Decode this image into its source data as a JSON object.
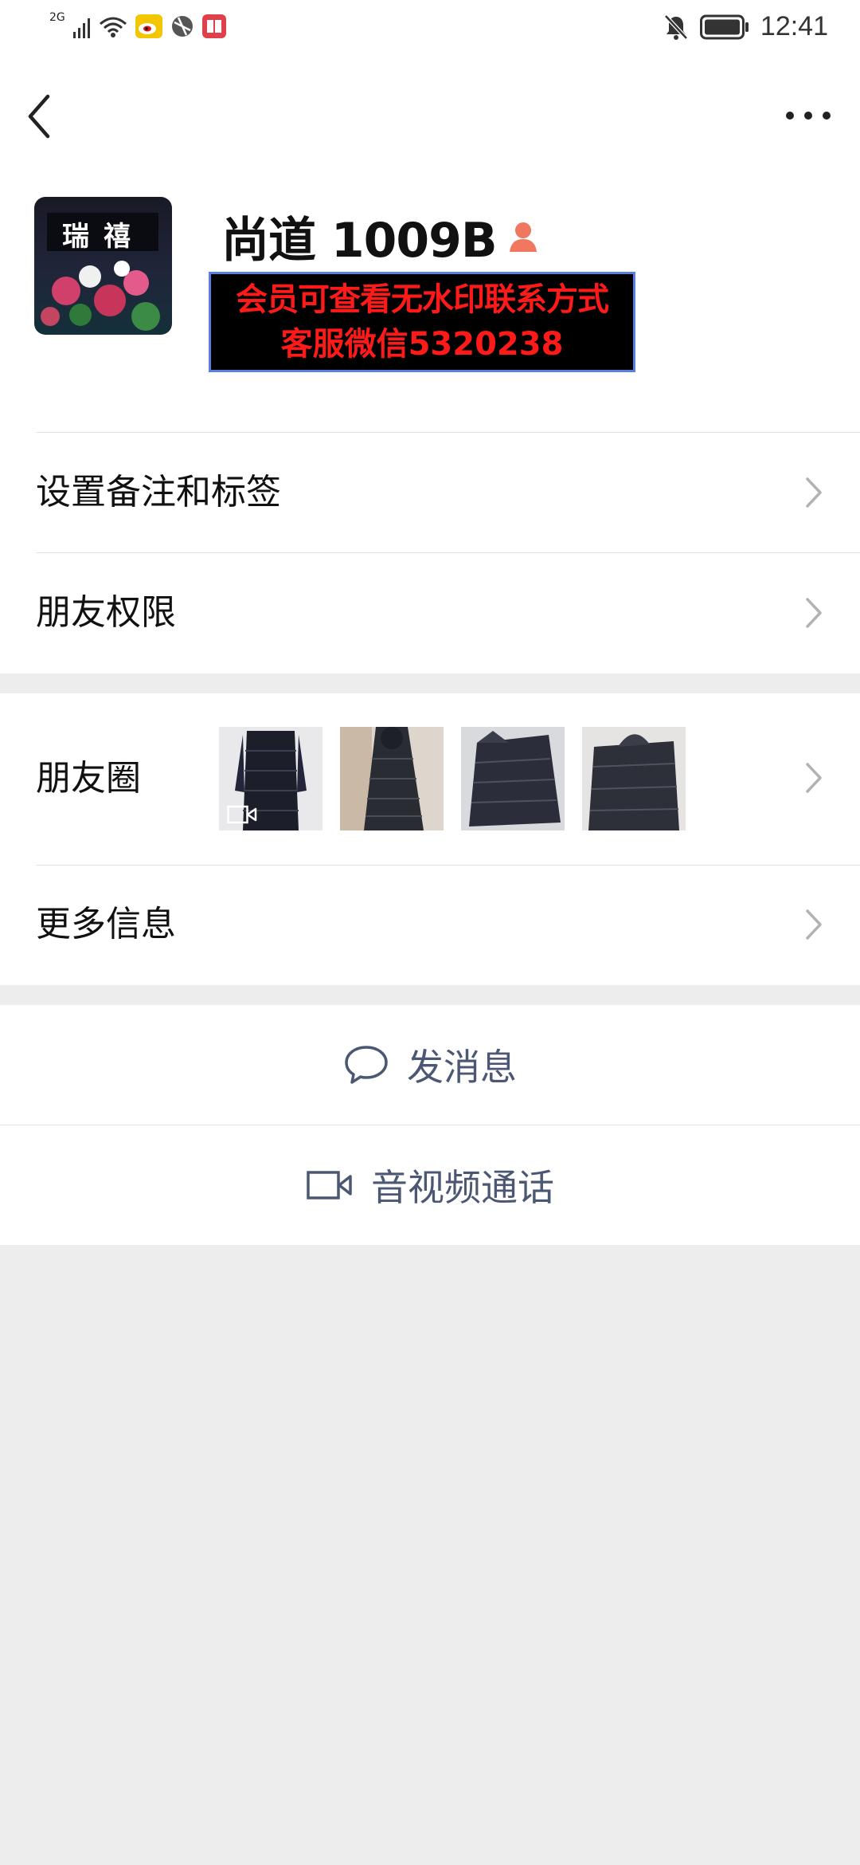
{
  "status_bar": {
    "network_type": "2G",
    "time": "12:41",
    "icons": [
      "signal-icon",
      "wifi-icon",
      "weibo-icon",
      "browser-icon",
      "reader-app-icon",
      "mute-bell-icon",
      "battery-icon"
    ]
  },
  "nav": {
    "back_icon": "chevron-left-icon",
    "more_icon": "more-dots-icon"
  },
  "profile": {
    "avatar_text": "瑞禧",
    "name": "尚道 1009B",
    "gender_icon": "female-icon",
    "notice_line1": "会员可查看无水印联系方式",
    "notice_line2": "客服微信5320238"
  },
  "menu": {
    "remark_tags": "设置备注和标签",
    "friend_permissions": "朋友权限",
    "moments": "朋友圈",
    "more_info": "更多信息"
  },
  "actions": {
    "send_message": "发消息",
    "video_call": "音视频通话"
  },
  "colors": {
    "action_text": "#4c5873",
    "notice_text": "#ff1a1a",
    "notice_border": "#5b7fe0",
    "page_background": "#ededed"
  }
}
